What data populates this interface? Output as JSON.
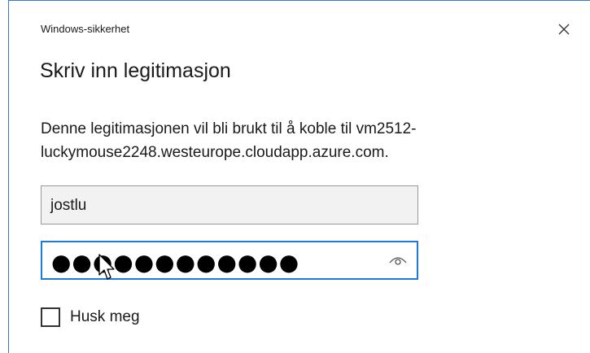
{
  "window": {
    "title": "Windows-sikkerhet",
    "close_icon": "close-icon"
  },
  "dialog": {
    "heading": "Skriv inn legitimasjon",
    "description": "Denne legitimasjonen vil bli brukt til å koble til vm2512-luckymouse2248.westeurope.cloudapp.azure.com."
  },
  "username": {
    "value": "jostlu"
  },
  "password": {
    "masked_value": "●●●●●●●●●●●●",
    "reveal_icon": "eye-icon",
    "focused": true
  },
  "remember": {
    "label": "Husk meg",
    "checked": false
  },
  "colors": {
    "focus_border": "#1e7ad6",
    "window_border": "#3c78c8"
  }
}
